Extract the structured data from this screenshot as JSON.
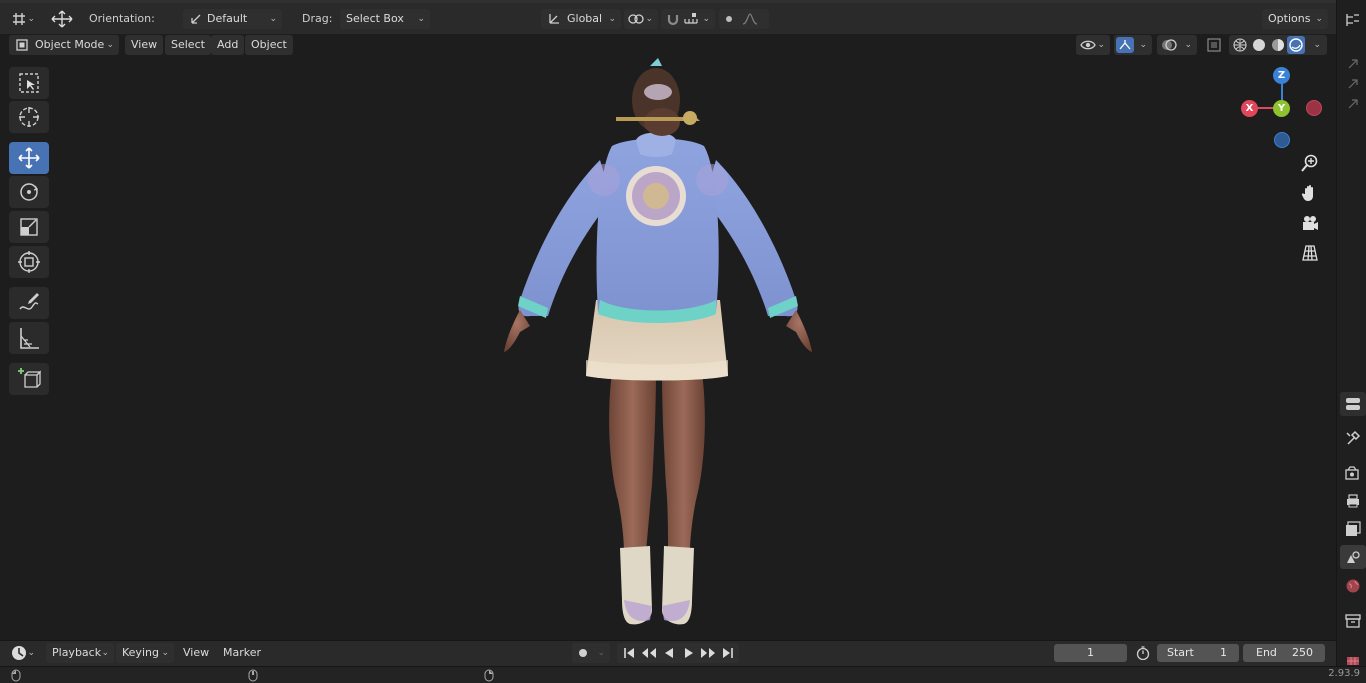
{
  "header": {
    "orientation_label": "Orientation:",
    "orientation_value": "Default",
    "drag_label": "Drag:",
    "drag_value": "Select Box",
    "transform_orientation": "Global",
    "options_label": "Options"
  },
  "viewport_header": {
    "mode": "Object Mode",
    "menus": [
      "View",
      "Select",
      "Add",
      "Object"
    ]
  },
  "toolbar": {
    "tools": [
      "select-box-icon",
      "cursor-icon",
      "move-icon",
      "rotate-icon",
      "scale-icon",
      "transform-icon",
      "annotate-icon",
      "measure-icon",
      "add-cube-icon"
    ],
    "active_tool": "move-icon"
  },
  "gizmo": {
    "x": "X",
    "y": "Y",
    "z": "Z"
  },
  "nav_icons": [
    "zoom-icon",
    "pan-hand-icon",
    "camera-icon",
    "ortho-grid-icon"
  ],
  "timeline": {
    "menus": [
      "Playback",
      "Keying",
      "View",
      "Marker"
    ],
    "current_frame": "1",
    "start_label": "Start",
    "start_value": "1",
    "end_label": "End",
    "end_value": "250"
  },
  "status": {
    "version": "2.93.9"
  },
  "colors": {
    "accent": "#4772b3",
    "x_axis": "#e0475a",
    "y_axis": "#8ec22e",
    "z_axis": "#3a82d8"
  }
}
